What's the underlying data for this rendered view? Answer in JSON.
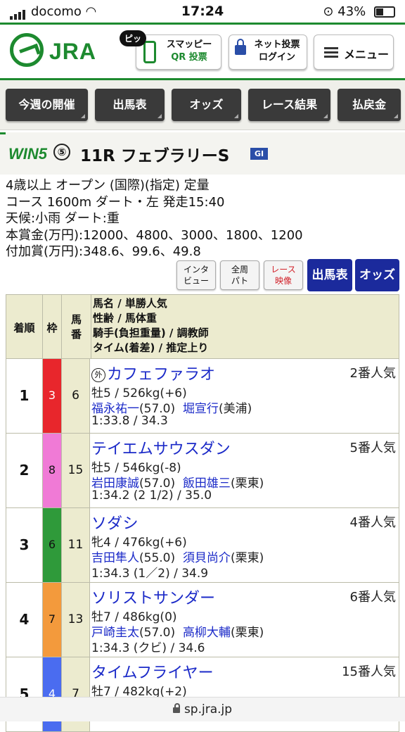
{
  "status": {
    "carrier": "docomo",
    "time": "17:24",
    "battery": "43%"
  },
  "header": {
    "logo_text": "JRA",
    "pip_label": "ピッ",
    "qr_line1": "スマッピー",
    "qr_line2": "QR 投票",
    "login_line1": "ネット投票",
    "login_line2": "ログイン",
    "menu_label": "メニュー"
  },
  "nav": [
    "今週の開催",
    "出馬表",
    "オッズ",
    "レース結果",
    "払戻金"
  ],
  "race": {
    "win5_label": "WIN5",
    "win5_no": "⑤",
    "title": "11R フェブラリーS",
    "grade": "GⅠ",
    "info": [
      "4歳以上 オープン (国際)(指定) 定量",
      "コース 1600m ダート・左 発走15:40",
      "天候:小雨 ダート:重",
      "本賞金(万円):12000、4800、3000、1800、1200",
      "付加賞(万円):348.6、99.6、49.8"
    ]
  },
  "buttons": {
    "interview": [
      "インタ",
      "ビュー"
    ],
    "patrol": [
      "全周",
      "パト"
    ],
    "video": [
      "レース",
      "映像"
    ],
    "entries": "出馬表",
    "odds": "オッズ"
  },
  "table": {
    "headers": {
      "rank": "着順",
      "waku": "枠",
      "num": [
        "馬",
        "番"
      ],
      "info": [
        "馬名 / 単勝人気",
        "性齢 / 馬体重",
        "騎手(負担重量) / 調教師",
        "タイム(着差) / 推定上り"
      ]
    },
    "rows": [
      {
        "rank": "1",
        "waku": "3",
        "waku_color": "#e8262c",
        "num": "6",
        "foreign": "外",
        "name": "カフェファラオ",
        "pop": "2番人気",
        "sexage": "牡5 / 526kg(+6)",
        "jockey": "福永祐一",
        "weight": "(57.0)",
        "trainer": "堀宣行",
        "stable": "(美浦)",
        "time": "1:33.8 / 34.3"
      },
      {
        "rank": "2",
        "waku": "8",
        "waku_color": "#f07ad6",
        "num": "15",
        "foreign": "",
        "name": "テイエムサウスダン",
        "pop": "5番人気",
        "sexage": "牡5 / 546kg(-8)",
        "jockey": "岩田康誠",
        "weight": "(57.0)",
        "trainer": "飯田雄三",
        "stable": "(栗東)",
        "time": "1:34.2 (2 1/2) / 35.0"
      },
      {
        "rank": "3",
        "waku": "6",
        "waku_color": "#2f9a3a",
        "num": "11",
        "foreign": "",
        "name": "ソダシ",
        "pop": "4番人気",
        "sexage": "牝4 / 476kg(+6)",
        "jockey": "吉田隼人",
        "weight": "(55.0)",
        "trainer": "須貝尚介",
        "stable": "(栗東)",
        "time": "1:34.3 (1／2) / 34.9"
      },
      {
        "rank": "4",
        "waku": "7",
        "waku_color": "#f39a3c",
        "num": "13",
        "foreign": "",
        "name": "ソリストサンダー",
        "pop": "6番人気",
        "sexage": "牡7 / 486kg(0)",
        "jockey": "戸崎圭太",
        "weight": "(57.0)",
        "trainer": "高柳大輔",
        "stable": "(栗東)",
        "time": "1:34.3 (クビ) / 34.6"
      },
      {
        "rank": "5",
        "waku": "4",
        "waku_color": "#4a6cf0",
        "num": "7",
        "foreign": "",
        "name": "タイムフライヤー",
        "pop": "15番人気",
        "sexage": "牡7 / 482kg(+2)",
        "jockey": "",
        "weight": "",
        "trainer": "",
        "stable": "",
        "time": ""
      }
    ]
  },
  "url": "sp.jra.jp",
  "colors": {
    "jra_green": "#1d8a2f",
    "link_blue": "#1b2ac8",
    "button_navy": "#1b2a9c"
  }
}
